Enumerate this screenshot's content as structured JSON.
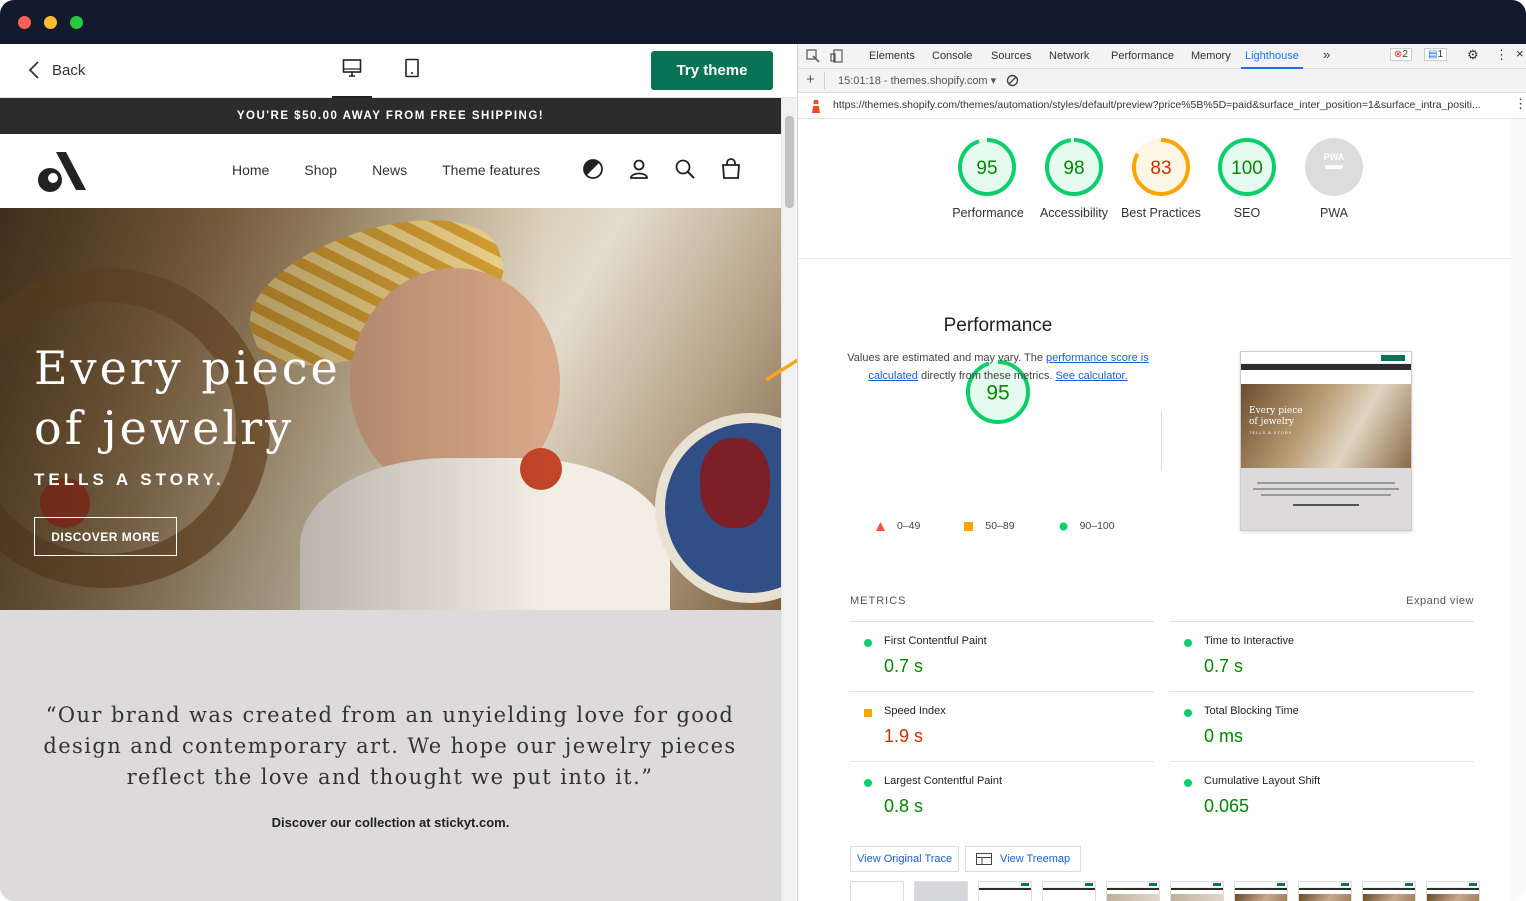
{
  "preview": {
    "back_label": "Back",
    "device_icons": [
      "desktop-icon",
      "mobile-icon"
    ],
    "try_theme_label": "Try theme",
    "brand_color": "#097455"
  },
  "site": {
    "announcement": "YOU'RE $50.00 AWAY FROM FREE SHIPPING!",
    "nav": [
      "Home",
      "Shop",
      "News",
      "Theme features"
    ],
    "nav_icons": [
      "contrast-icon",
      "account-icon",
      "search-icon",
      "cart-icon"
    ],
    "hero": {
      "title": "Every piece\nof jewelry",
      "subtitle": "TELLS A STORY.",
      "button": "DISCOVER MORE"
    },
    "quote": "“Our brand was created from an unyielding love for good design and contemporary art. We hope our jewelry pieces reflect the love and thought we put into it.”",
    "quote_cta": "Discover our collection at stickyt.com."
  },
  "devtools": {
    "tabs": [
      "Elements",
      "Console",
      "Sources",
      "Network",
      "Performance",
      "Memory",
      "Lighthouse"
    ],
    "active_tab": "Lighthouse",
    "error_count": "2",
    "message_count": "1",
    "report_selector": "15:01:18 - themes.shopify.com",
    "url": "https://themes.shopify.com/themes/automation/styles/default/preview?price%5B%5D=paid&surface_inter_position=1&surface_intra_positi...",
    "scores": [
      {
        "value": 95,
        "label": "Performance",
        "status": "pass"
      },
      {
        "value": 98,
        "label": "Accessibility",
        "status": "pass"
      },
      {
        "value": 83,
        "label": "Best Practices",
        "status": "average"
      },
      {
        "value": 100,
        "label": "SEO",
        "status": "pass"
      },
      {
        "value": null,
        "label": "PWA",
        "badge": "PWA",
        "status": "na"
      }
    ],
    "performance": {
      "score": 95,
      "title": "Performance",
      "note_prefix": "Values are estimated and may vary. The ",
      "note_link": "performance score is calculated",
      "note_mid": " directly from these metrics. ",
      "note_link2": "See calculator.",
      "legend": [
        "0–49",
        "50–89",
        "90–100"
      ]
    },
    "metrics_title": "METRICS",
    "expand_label": "Expand view",
    "metrics": [
      {
        "label": "First Contentful Paint",
        "value": "0.7 s",
        "status": "pass"
      },
      {
        "label": "Time to Interactive",
        "value": "0.7 s",
        "status": "pass"
      },
      {
        "label": "Speed Index",
        "value": "1.9 s",
        "status": "average"
      },
      {
        "label": "Total Blocking Time",
        "value": "0 ms",
        "status": "pass"
      },
      {
        "label": "Largest Contentful Paint",
        "value": "0.8 s",
        "status": "pass"
      },
      {
        "label": "Cumulative Layout Shift",
        "value": "0.065",
        "status": "pass"
      }
    ],
    "buttons": {
      "trace": "View Original Trace",
      "treemap": "View Treemap"
    },
    "thumbnail": {
      "hero_title": "Every piece of jewelry",
      "hero_sub": "TELLS A STORY"
    },
    "colors": {
      "pass": "#0cce6b",
      "pass_text": "#008800",
      "average": "#ffa400",
      "average_text": "#c33300",
      "fail": "#ff4e42",
      "link": "#1a5fd0"
    }
  }
}
